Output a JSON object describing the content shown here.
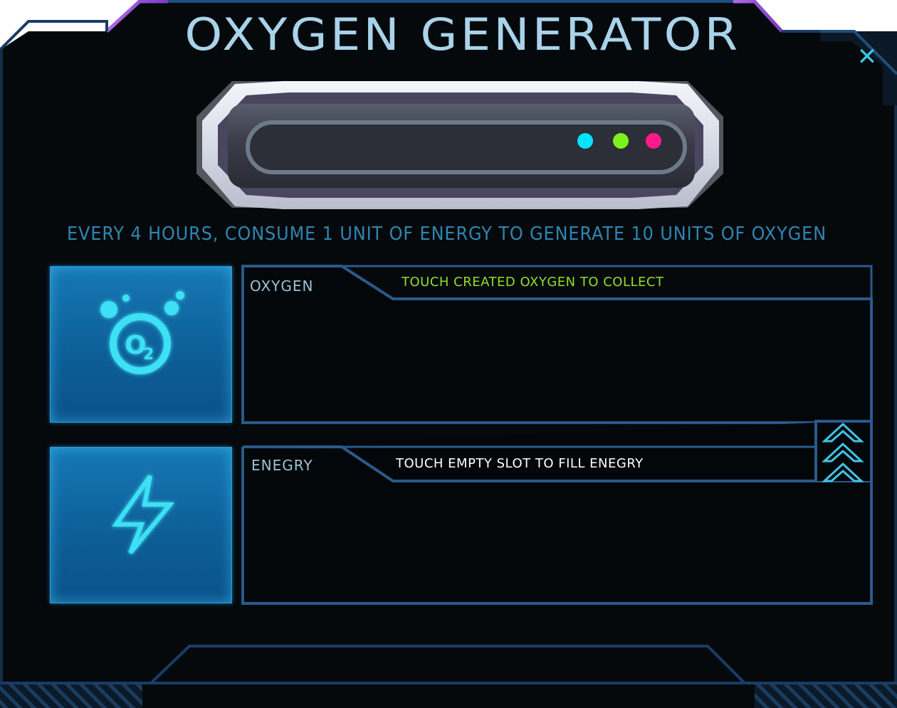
{
  "window": {
    "title": "OXYGEN GENERATOR",
    "close_icon": "close-icon",
    "close_glyph": "✕"
  },
  "generator": {
    "indicator_colors": [
      "#00e5ff",
      "#7cf21c",
      "#ff1a8c"
    ]
  },
  "description": "EVERY 4 HOURS, CONSUME 1 UNIT OF ENERGY TO GENERATE 10 UNITS OF OXYGEN",
  "oxygen_panel": {
    "label": "OXYGEN",
    "hint": "TOUCH CREATED OXYGEN TO COLLECT",
    "hint_color": "#8ee02a",
    "icon": "o2-bubbles-icon",
    "icon_text": "O2"
  },
  "energy_panel": {
    "label": "ENEGRY",
    "hint": "TOUCH EMPTY SLOT TO FILL ENEGRY",
    "hint_color": "#ffffff",
    "icon": "lightning-bolt-icon"
  },
  "upgrade": {
    "icon": "triple-chevron-up-icon"
  },
  "colors": {
    "frame_bg": "#05090c",
    "frame_border": "#1a3c66",
    "accent_cyan": "#3ec6e6",
    "accent_purple": "#9b52d6",
    "title": "#a9d3ea",
    "description": "#2f86b2"
  }
}
